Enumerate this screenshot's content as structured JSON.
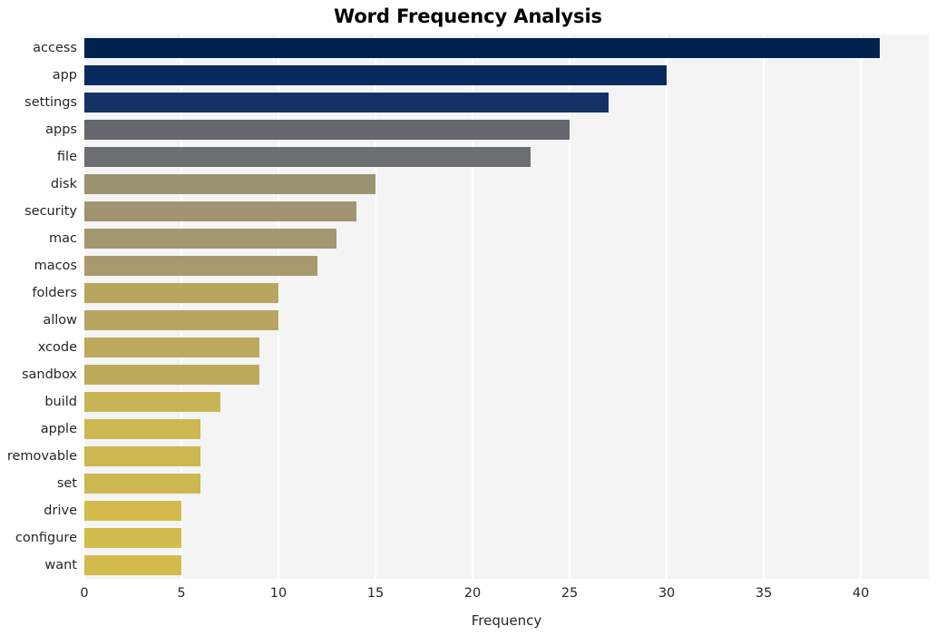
{
  "chart_data": {
    "type": "bar",
    "orientation": "horizontal",
    "title": "Word Frequency Analysis",
    "xlabel": "Frequency",
    "ylabel": "",
    "categories": [
      "access",
      "app",
      "settings",
      "apps",
      "file",
      "disk",
      "security",
      "mac",
      "macos",
      "folders",
      "allow",
      "xcode",
      "sandbox",
      "build",
      "apple",
      "removable",
      "set",
      "drive",
      "configure",
      "want"
    ],
    "values": [
      41,
      30,
      27,
      25,
      23,
      15,
      14,
      13,
      12,
      10,
      10,
      9,
      9,
      7,
      6,
      6,
      6,
      5,
      5,
      5
    ],
    "bar_colors": [
      "#00224e",
      "#474f६f",
      "#5b5f६f",
      "#66666f",
      "#6d6e72",
      "#9c9373",
      "#a09471",
      "#a4976f",
      "#a89a6c",
      "#b7a560",
      "#b7a560",
      "#bda95c",
      "#bda95c",
      "#c9b455",
      "#cdb751",
      "#cdb751",
      "#cdb751",
      "#d3bb4e",
      "#d3bb4e",
      "#d3bb4e"
    ],
    "xlim": [
      0,
      43.5
    ],
    "xticks": [
      0,
      5,
      10,
      15,
      20,
      25,
      30,
      35,
      40
    ],
    "xtick_labels": [
      "0",
      "5",
      "10",
      "15",
      "20",
      "25",
      "30",
      "35",
      "40"
    ],
    "grid": "vertical-only",
    "grid_color": "#ffffff",
    "plot_background": "#f4f4f5",
    "figure_background": "#ffffff",
    "legend": "none",
    "colormap": "cividis"
  }
}
